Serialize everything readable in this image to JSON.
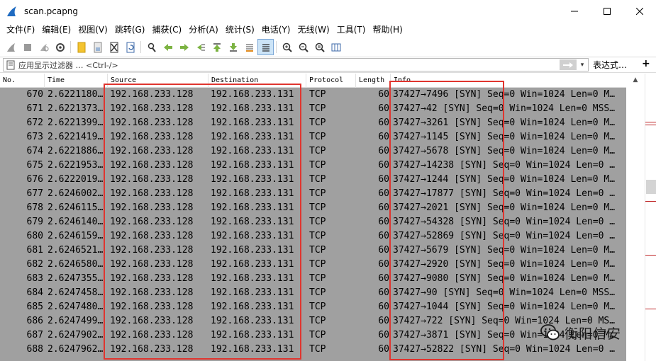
{
  "window": {
    "title": "scan.pcapng",
    "controls": [
      "minimize",
      "maximize",
      "close"
    ]
  },
  "menu": [
    "文件(F)",
    "编辑(E)",
    "视图(V)",
    "跳转(G)",
    "捕获(C)",
    "分析(A)",
    "统计(S)",
    "电话(Y)",
    "无线(W)",
    "工具(T)",
    "帮助(H)"
  ],
  "filter": {
    "placeholder": "应用显示过滤器 … <Ctrl-/>",
    "expression_label": "表达式…",
    "add_label": "+"
  },
  "columns": {
    "no": "No.",
    "time": "Time",
    "source": "Source",
    "destination": "Destination",
    "protocol": "Protocol",
    "length": "Length",
    "info": "Info"
  },
  "packets": [
    {
      "no": "670",
      "time": "2.6221180…",
      "src": "192.168.233.128",
      "dst": "192.168.233.131",
      "proto": "TCP",
      "len": "60",
      "info": "37427→7496 [SYN] Seq=0 Win=1024 Len=0 M…"
    },
    {
      "no": "671",
      "time": "2.6221373…",
      "src": "192.168.233.128",
      "dst": "192.168.233.131",
      "proto": "TCP",
      "len": "60",
      "info": "37427→42 [SYN] Seq=0 Win=1024 Len=0 MSS…"
    },
    {
      "no": "672",
      "time": "2.6221399…",
      "src": "192.168.233.128",
      "dst": "192.168.233.131",
      "proto": "TCP",
      "len": "60",
      "info": "37427→3261 [SYN] Seq=0 Win=1024 Len=0 M…"
    },
    {
      "no": "673",
      "time": "2.6221419…",
      "src": "192.168.233.128",
      "dst": "192.168.233.131",
      "proto": "TCP",
      "len": "60",
      "info": "37427→1145 [SYN] Seq=0 Win=1024 Len=0 M…"
    },
    {
      "no": "674",
      "time": "2.6221886…",
      "src": "192.168.233.128",
      "dst": "192.168.233.131",
      "proto": "TCP",
      "len": "60",
      "info": "37427→5678 [SYN] Seq=0 Win=1024 Len=0 M…"
    },
    {
      "no": "675",
      "time": "2.6221953…",
      "src": "192.168.233.128",
      "dst": "192.168.233.131",
      "proto": "TCP",
      "len": "60",
      "info": "37427→14238 [SYN] Seq=0 Win=1024 Len=0 …"
    },
    {
      "no": "676",
      "time": "2.6222019…",
      "src": "192.168.233.128",
      "dst": "192.168.233.131",
      "proto": "TCP",
      "len": "60",
      "info": "37427→1244 [SYN] Seq=0 Win=1024 Len=0 M…"
    },
    {
      "no": "677",
      "time": "2.6246002…",
      "src": "192.168.233.128",
      "dst": "192.168.233.131",
      "proto": "TCP",
      "len": "60",
      "info": "37427→17877 [SYN] Seq=0 Win=1024 Len=0 …"
    },
    {
      "no": "678",
      "time": "2.6246115…",
      "src": "192.168.233.128",
      "dst": "192.168.233.131",
      "proto": "TCP",
      "len": "60",
      "info": "37427→2021 [SYN] Seq=0 Win=1024 Len=0 M…"
    },
    {
      "no": "679",
      "time": "2.6246140…",
      "src": "192.168.233.128",
      "dst": "192.168.233.131",
      "proto": "TCP",
      "len": "60",
      "info": "37427→54328 [SYN] Seq=0 Win=1024 Len=0 …"
    },
    {
      "no": "680",
      "time": "2.6246159…",
      "src": "192.168.233.128",
      "dst": "192.168.233.131",
      "proto": "TCP",
      "len": "60",
      "info": "37427→52869 [SYN] Seq=0 Win=1024 Len=0 …"
    },
    {
      "no": "681",
      "time": "2.6246521…",
      "src": "192.168.233.128",
      "dst": "192.168.233.131",
      "proto": "TCP",
      "len": "60",
      "info": "37427→5679 [SYN] Seq=0 Win=1024 Len=0 M…"
    },
    {
      "no": "682",
      "time": "2.6246580…",
      "src": "192.168.233.128",
      "dst": "192.168.233.131",
      "proto": "TCP",
      "len": "60",
      "info": "37427→2920 [SYN] Seq=0 Win=1024 Len=0 M…"
    },
    {
      "no": "683",
      "time": "2.6247355…",
      "src": "192.168.233.128",
      "dst": "192.168.233.131",
      "proto": "TCP",
      "len": "60",
      "info": "37427→9080 [SYN] Seq=0 Win=1024 Len=0 M…"
    },
    {
      "no": "684",
      "time": "2.6247458…",
      "src": "192.168.233.128",
      "dst": "192.168.233.131",
      "proto": "TCP",
      "len": "60",
      "info": "37427→90 [SYN] Seq=0 Win=1024 Len=0 MSS…"
    },
    {
      "no": "685",
      "time": "2.6247480…",
      "src": "192.168.233.128",
      "dst": "192.168.233.131",
      "proto": "TCP",
      "len": "60",
      "info": "37427→1044 [SYN] Seq=0 Win=1024 Len=0 M…"
    },
    {
      "no": "686",
      "time": "2.6247499…",
      "src": "192.168.233.128",
      "dst": "192.168.233.131",
      "proto": "TCP",
      "len": "60",
      "info": "37427→722 [SYN] Seq=0 Win=1024 Len=0 MS…"
    },
    {
      "no": "687",
      "time": "2.6247902…",
      "src": "192.168.233.128",
      "dst": "192.168.233.131",
      "proto": "TCP",
      "len": "60",
      "info": "37427→3871 [SYN] Seq=0 Win=1024 Len=0 M…"
    },
    {
      "no": "688",
      "time": "2.6247962…",
      "src": "192.168.233.128",
      "dst": "192.168.233.131",
      "proto": "TCP",
      "len": "60",
      "info": "37427→52822 [SYN] Seq=0 Win=1024 Len=0 …"
    }
  ],
  "watermark": {
    "text": "衡阳信安"
  },
  "colors": {
    "row_bg": "#a0a0a0",
    "highlight_border": "#e0352f",
    "wireshark_fin": "#1f6bc1"
  },
  "icons": {
    "app": "wireshark-fin-icon",
    "toolbar": [
      "start-capture-icon",
      "stop-capture-icon",
      "restart-capture-icon",
      "capture-options-icon",
      "open-file-icon",
      "save-file-icon",
      "close-file-icon",
      "reload-icon",
      "find-packet-icon",
      "go-back-icon",
      "go-forward-icon",
      "go-to-packet-icon",
      "go-first-icon",
      "go-last-icon",
      "autoscroll-icon",
      "colorize-icon",
      "zoom-in-icon",
      "zoom-out-icon",
      "zoom-normal-icon",
      "resize-columns-icon"
    ]
  }
}
